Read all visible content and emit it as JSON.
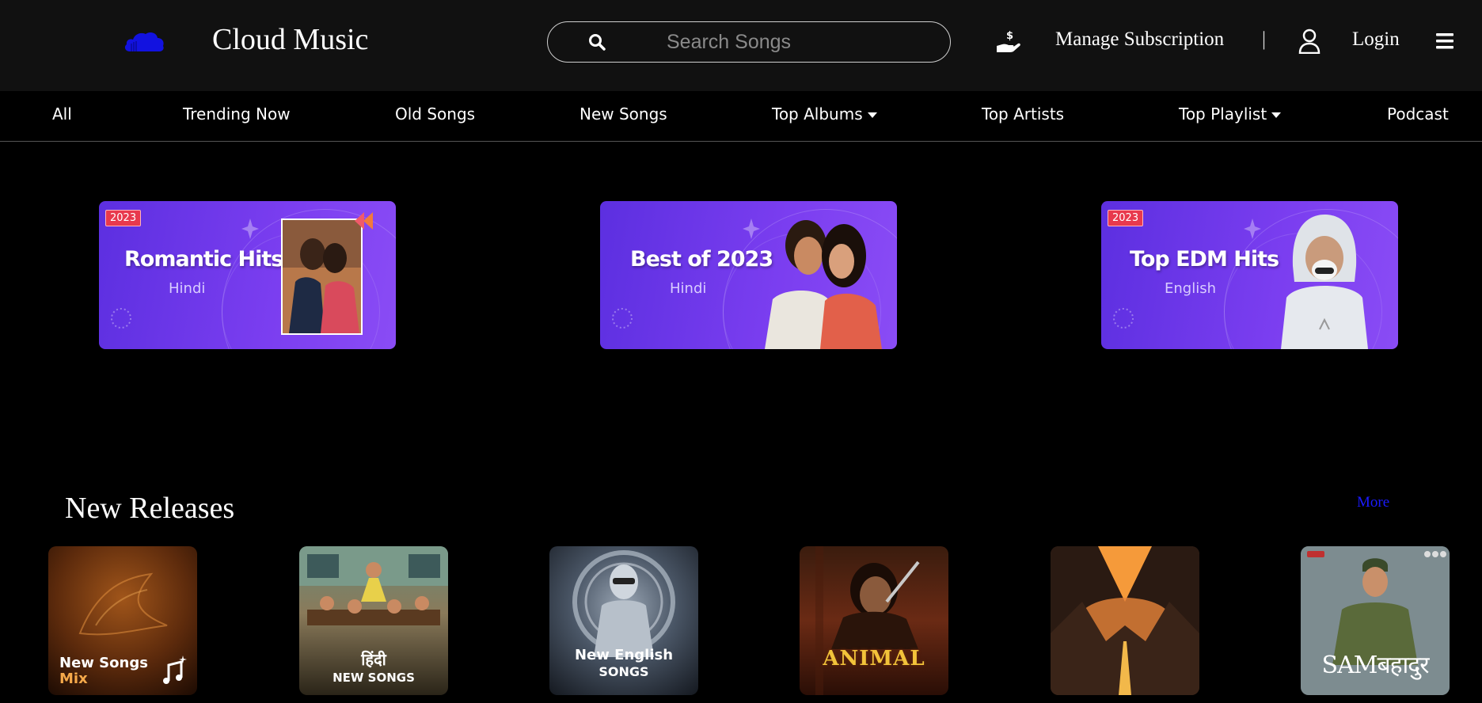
{
  "header": {
    "app_title": "Cloud Music",
    "logo_icon": "cloud-icon",
    "search": {
      "placeholder": "Search Songs",
      "value": ""
    },
    "manage_subscription": "Manage Subscription",
    "separator": "|",
    "login": "Login",
    "icons": [
      "search-icon",
      "subscription-icon",
      "user-icon",
      "hamburger-menu-icon"
    ]
  },
  "nav": {
    "items": [
      {
        "label": "All",
        "dropdown": false
      },
      {
        "label": "Trending Now",
        "dropdown": false
      },
      {
        "label": "Old Songs",
        "dropdown": false
      },
      {
        "label": "New Songs",
        "dropdown": false
      },
      {
        "label": "Top Albums",
        "dropdown": true
      },
      {
        "label": "Top Artists",
        "dropdown": false
      },
      {
        "label": "Top Playlist",
        "dropdown": true
      },
      {
        "label": "Podcast",
        "dropdown": false
      }
    ]
  },
  "banners": [
    {
      "badge": "2023",
      "title": "Romantic Hits",
      "subtitle": "Hindi"
    },
    {
      "badge": "",
      "title": "Best of 2023",
      "subtitle": "Hindi"
    },
    {
      "badge": "2023",
      "title": "Top EDM Hits",
      "subtitle": "English"
    }
  ],
  "new_releases": {
    "title": "New Releases",
    "more": "More",
    "cards": [
      {
        "line1": "New Songs",
        "line2": "Mix"
      },
      {
        "line1": "हिंदी",
        "line2": "NEW SONGS"
      },
      {
        "line1": "New English",
        "line2": "SONGS"
      },
      {
        "line1": "ANIMAL",
        "line2": ""
      },
      {
        "line1": "",
        "line2": ""
      },
      {
        "line1": "SAMबहादुर",
        "line2": ""
      }
    ]
  },
  "colors": {
    "header_bg": "#111111",
    "page_bg": "#000000",
    "banner_purple": "#6f35ea",
    "more_link": "#1a1aff",
    "logo_blue": "#1212e0",
    "badge_red": "#e8394d"
  }
}
